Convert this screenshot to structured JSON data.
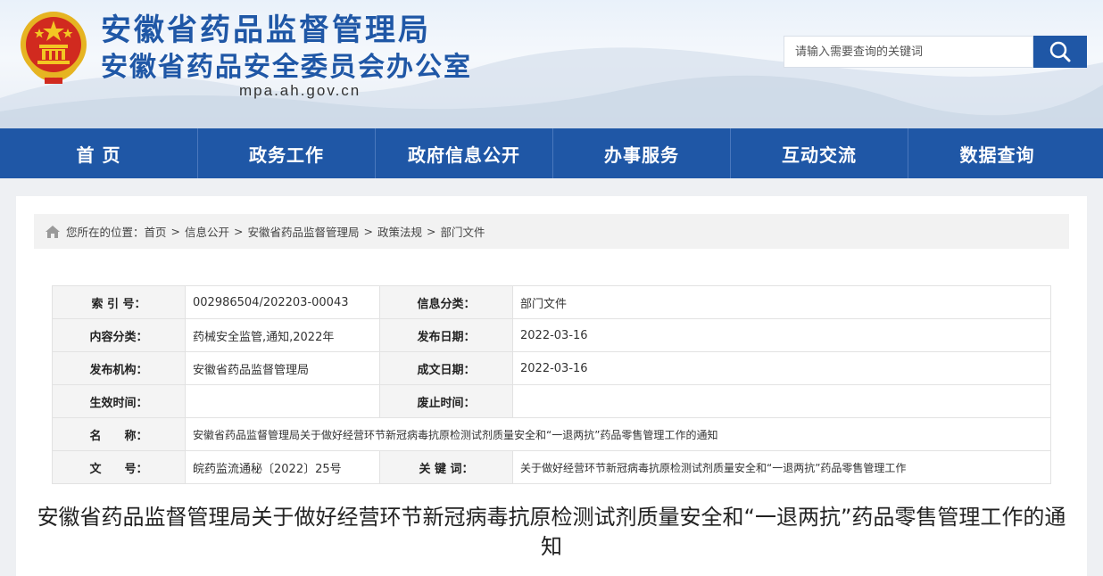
{
  "header": {
    "title_line1": "安徽省药品监督管理局",
    "title_line2": "安徽省药品安全委员会办公室",
    "domain": "mpa.ah.gov.cn",
    "search": {
      "placeholder": "请输入需要查询的关键词"
    },
    "colors": {
      "brand": "#1f57a6"
    }
  },
  "nav": {
    "items": [
      {
        "label": "首 页"
      },
      {
        "label": "政务工作"
      },
      {
        "label": "政府信息公开"
      },
      {
        "label": "办事服务"
      },
      {
        "label": "互动交流"
      },
      {
        "label": "数据查询"
      }
    ]
  },
  "breadcrumb": {
    "prefix": "您所在的位置：",
    "separator": ">",
    "items": [
      "首页",
      "信息公开",
      "安徽省药品监督管理局",
      "政策法规",
      "部门文件"
    ]
  },
  "meta_table": {
    "rows": [
      {
        "k1": "索 引 号：",
        "v1": "002986504/202203-00043",
        "k2": "信息分类：",
        "v2": "部门文件"
      },
      {
        "k1": "内容分类：",
        "v1": "药械安全监管,通知,2022年",
        "k2": "发布日期：",
        "v2": "2022-03-16"
      },
      {
        "k1": "发布机构：",
        "v1": "安徽省药品监督管理局",
        "k2": "成文日期：",
        "v2": "2022-03-16"
      },
      {
        "k1": "生效时间：",
        "v1": "",
        "k2": "废止时间：",
        "v2": ""
      }
    ],
    "name_row": {
      "k": "名　　称：",
      "v": "安徽省药品监督管理局关于做好经营环节新冠病毒抗原检测试剂质量安全和“一退两抗”药品零售管理工作的通知"
    },
    "last_row": {
      "k1": "文　　号：",
      "v1": "皖药监流通秘〔2022〕25号",
      "k2": "关 键 词：",
      "v2": "关于做好经营环节新冠病毒抗原检测试剂质量安全和“一退两抗”药品零售管理工作"
    }
  },
  "document": {
    "title": "安徽省药品监督管理局关于做好经营环节新冠病毒抗原检测试剂质量安全和“一退两抗”药品零售管理工作的通知"
  }
}
